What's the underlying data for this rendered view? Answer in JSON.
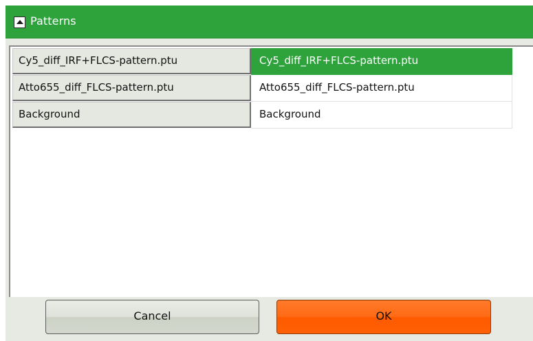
{
  "dialog": {
    "title": "Patterns",
    "accent_color": "#2ea33c",
    "ok_color": "#ff6a14"
  },
  "patterns": {
    "rows": [
      {
        "left": "Cy5_diff_IRF+FLCS-pattern.ptu",
        "right": "Cy5_diff_IRF+FLCS-pattern.ptu",
        "selected": true
      },
      {
        "left": "Atto655_diff_FLCS-pattern.ptu",
        "right": "Atto655_diff_FLCS-pattern.ptu",
        "selected": false
      },
      {
        "left": "Background",
        "right": "Background",
        "selected": false
      }
    ]
  },
  "buttons": {
    "cancel_label": "Cancel",
    "ok_label": "OK"
  },
  "icons": {
    "collapse": "collapse-up-triangle-icon"
  }
}
